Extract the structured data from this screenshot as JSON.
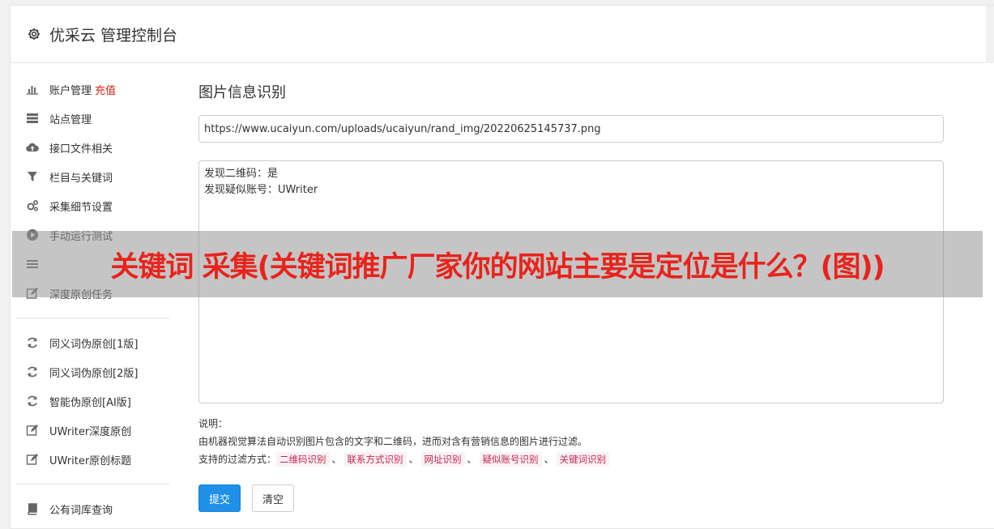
{
  "header": {
    "title": "优采云 管理控制台",
    "icon": "gear-icon"
  },
  "sidebar": {
    "group1": [
      {
        "label": "账户管理",
        "badge": "充值",
        "icon": "bar-chart-icon"
      },
      {
        "label": "站点管理",
        "icon": "server-icon"
      },
      {
        "label": "接口文件相关",
        "icon": "cloud-upload-icon"
      },
      {
        "label": "栏目与关键词",
        "icon": "filter-icon"
      },
      {
        "label": "采集细节设置",
        "icon": "gears-icon"
      },
      {
        "label": "手动运行测试",
        "icon": "play-icon"
      },
      {
        "label": "",
        "icon": "list-icon"
      },
      {
        "label": "深度原创任务",
        "icon": "edit-icon"
      }
    ],
    "group2": [
      {
        "label": "同义词伪原创[1版]",
        "icon": "refresh-icon"
      },
      {
        "label": "同义词伪原创[2版]",
        "icon": "refresh-icon"
      },
      {
        "label": "智能伪原创[AI版]",
        "icon": "refresh-icon"
      },
      {
        "label": "UWriter深度原创",
        "icon": "edit-icon"
      },
      {
        "label": "UWriter原创标题",
        "icon": "edit-icon"
      }
    ],
    "group3": [
      {
        "label": "公有词库查询",
        "icon": "book-icon"
      }
    ]
  },
  "main": {
    "title": "图片信息识别",
    "url_value": "https://www.ucaiyun.com/uploads/ucaiyun/rand_img/20220625145737.png",
    "result_text": "发现二维码：是\n发现疑似账号：UWriter",
    "desc_label": "说明：",
    "desc_text": "由机器视觉算法自动识别图片包含的文字和二维码，进而对含有营销信息的图片进行过滤。",
    "filter_label": "支持的过滤方式：",
    "filters": [
      "二维码识别",
      "联系方式识别",
      "网址识别",
      "疑似账号识别",
      "关键词识别"
    ],
    "filter_separator": "、",
    "submit_label": "提交",
    "clear_label": "清空"
  },
  "banner": {
    "text": "关键词 采集(关键词推广厂家你的网站主要是定位是什么？(图))"
  },
  "colors": {
    "primary": "#1e90e8",
    "badge": "#d9230f",
    "banner_text": "#e8231b",
    "tag_text": "#c7254e",
    "tag_bg": "#f9f2f4"
  }
}
